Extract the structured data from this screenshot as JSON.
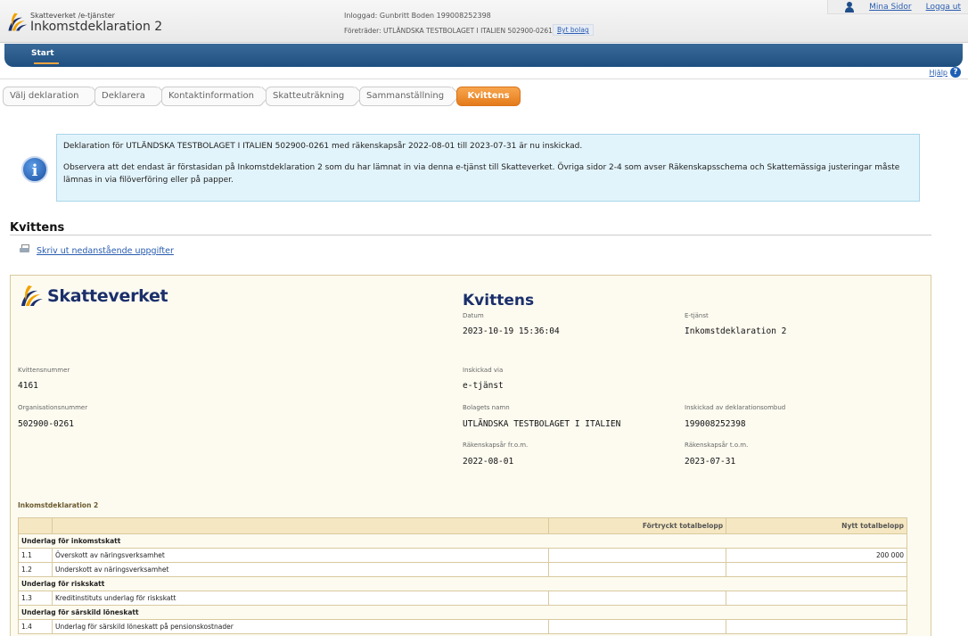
{
  "header": {
    "org": "Skatteverket /e-tjänster",
    "app_title": "Inkomstdeklaration 2",
    "logged_in": "Inloggad: Gunbritt Boden 199008252398",
    "representative": "Företräder: UTLÄNDSKA TESTBOLAGET I ITALIEN 502900-0261",
    "switch_company": "Byt bolag",
    "my_pages": "Mina Sidor",
    "logout": "Logga ut"
  },
  "nav": {
    "start": "Start",
    "help": "Hjälp"
  },
  "steps": [
    {
      "label": "Välj deklaration"
    },
    {
      "label": "Deklarera"
    },
    {
      "label": "Kontaktinformation"
    },
    {
      "label": "Skatteuträkning"
    },
    {
      "label": "Sammanställning"
    },
    {
      "label": "Kvittens"
    }
  ],
  "info": {
    "line1": "Deklaration för UTLÄNDSKA TESTBOLAGET I ITALIEN 502900-0261 med räkenskapsår 2022-08-01 till 2023-07-31 är nu inskickad.",
    "line2": "Observera att det endast är förstasidan på Inkomstdeklaration 2 som du har lämnat in via denna e-tjänst till Skatteverket. Övriga sidor 2-4 som avser Räkenskapsschema och Skattemässiga justeringar måste lämnas in via filöverföring eller på papper."
  },
  "section": {
    "title": "Kvittens",
    "print_link": "Skriv ut nedanstående uppgifter"
  },
  "receipt": {
    "brand": "Skatteverket",
    "title": "Kvittens",
    "fields": {
      "datum_label": "Datum",
      "datum": "2023-10-19 15:36:04",
      "etjanst_label": "E-tjänst",
      "etjanst": "Inkomstdeklaration 2",
      "kvittensnummer_label": "Kvittensnummer",
      "kvittensnummer": "4161",
      "inskickad_via_label": "Inskickad via",
      "inskickad_via": "e-tjänst",
      "orgnr_label": "Organisationsnummer",
      "orgnr": "502900-0261",
      "bolag_label": "Bolagets namn",
      "bolag": "UTLÄNDSKA TESTBOLAGET I ITALIEN",
      "ombud_label": "Inskickad av deklarationsombud",
      "ombud": "199008252398",
      "from_label": "Räkenskapsår fr.o.m.",
      "from": "2022-08-01",
      "tom_label": "Räkenskapsår t.o.m.",
      "tom": "2023-07-31"
    },
    "table": {
      "heading": "Inkomstdeklaration 2",
      "col_pre": "Förtryckt totalbelopp",
      "col_new": "Nytt totalbelopp",
      "groups": [
        {
          "title": "Underlag för inkomstskatt",
          "rows": [
            {
              "num": "1.1",
              "label": "Överskott av näringsverksamhet",
              "pre": "",
              "new": "200 000"
            },
            {
              "num": "1.2",
              "label": "Underskott av näringsverksamhet",
              "pre": "",
              "new": ""
            }
          ]
        },
        {
          "title": "Underlag för riskskatt",
          "rows": [
            {
              "num": "1.3",
              "label": "Kreditinstituts underlag för riskskatt",
              "pre": "",
              "new": ""
            }
          ]
        },
        {
          "title": "Underlag för särskild löneskatt",
          "rows": [
            {
              "num": "1.4",
              "label": "Underlag för särskild löneskatt på pensionskostnader",
              "pre": "",
              "new": ""
            }
          ]
        }
      ]
    }
  },
  "colors": {
    "nav": "#1e4f80",
    "active_step": "#f08c2c",
    "info_bg": "#e2f4fb",
    "receipt_bg": "#fdfbf0",
    "brand": "#1b2f6b"
  },
  "icons": [
    "skatteverket-logo-icon",
    "user-icon",
    "help-icon",
    "info-icon",
    "printer-icon"
  ]
}
